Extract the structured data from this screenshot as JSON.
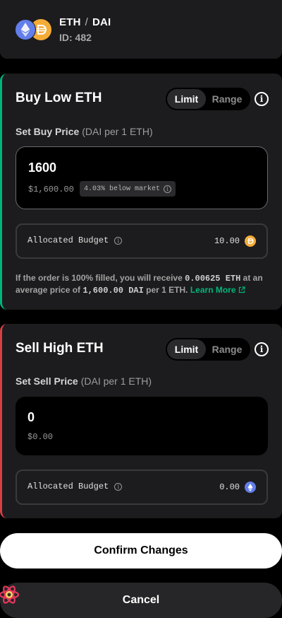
{
  "header": {
    "base_token": "ETH",
    "separator": "/",
    "quote_token": "DAI",
    "id_label": "ID: 482",
    "icons": [
      "eth-icon",
      "dai-icon"
    ]
  },
  "buy": {
    "title": "Buy Low ETH",
    "toggle": {
      "limit": "Limit",
      "range": "Range",
      "selected": "Limit"
    },
    "set_label": "Set Buy Price",
    "unit_label": "(DAI per 1 ETH)",
    "price_value": "1600",
    "price_fiat": "$1,600.00",
    "market_badge": "4.03% below market",
    "budget_label": "Allocated Budget",
    "budget_value": "10.00",
    "budget_token_icon": "dai-icon",
    "summary": {
      "part1": "If the order is 100% filled, you will receive ",
      "receive_amount": "0.00625 ETH",
      "part2": " at an average price of ",
      "avg_price": "1,600.00 DAI",
      "part3": " per 1 ETH. ",
      "learn_more": "Learn More"
    },
    "accent_color": "#00b578"
  },
  "sell": {
    "title": "Sell High ETH",
    "toggle": {
      "limit": "Limit",
      "range": "Range",
      "selected": "Limit"
    },
    "set_label": "Set Sell Price",
    "unit_label": "(DAI per 1 ETH)",
    "price_value": "0",
    "price_fiat": "$0.00",
    "budget_label": "Allocated Budget",
    "budget_value": "0.00",
    "budget_token_icon": "eth-icon",
    "accent_color": "#d84040"
  },
  "actions": {
    "confirm": "Confirm Changes",
    "cancel": "Cancel"
  }
}
